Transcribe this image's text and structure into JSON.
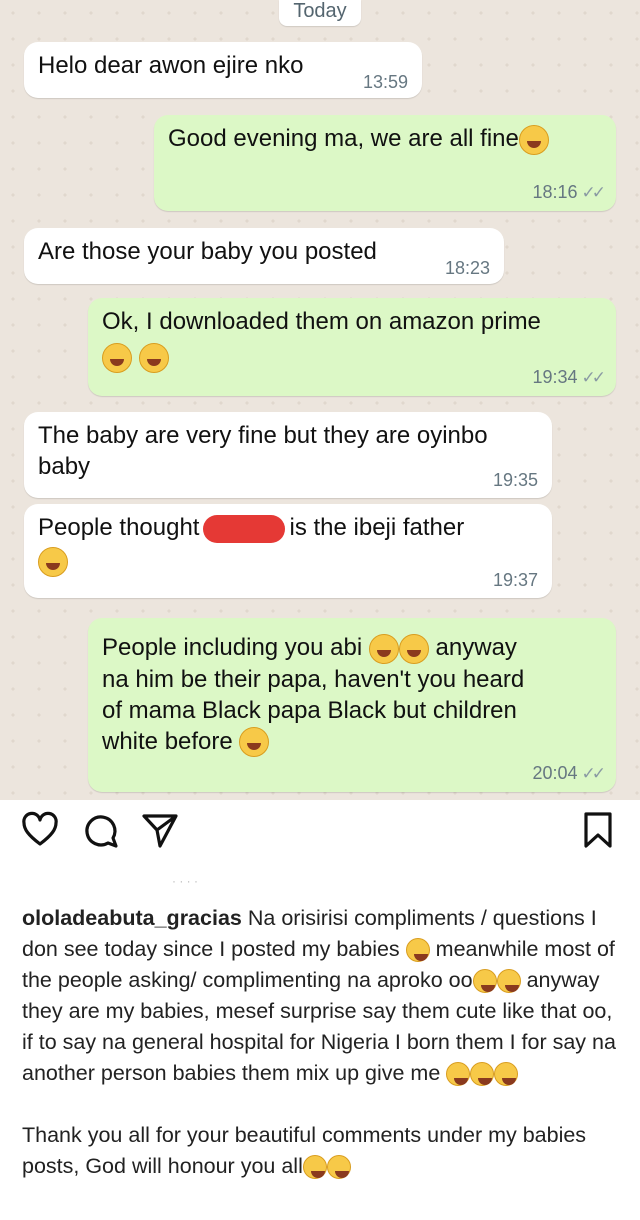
{
  "chat": {
    "date_label": "Today",
    "messages": [
      {
        "text": "Helo dear awon ejire nko",
        "time": "13:59"
      },
      {
        "text": "Good evening ma, we are all fine",
        "time": "18:16"
      },
      {
        "text": "Are those your baby you posted",
        "time": "18:23"
      },
      {
        "text": "Ok, I downloaded them on amazon prime",
        "time": "19:34"
      },
      {
        "text_line1": "The baby are very fine but they are oyinbo",
        "text_line2": "baby",
        "time": "19:35"
      },
      {
        "text_before": "People thought",
        "text_after": "is the ibeji father",
        "time": "19:37"
      },
      {
        "line1_before": "People including you abi",
        "line1_after": "anyway",
        "line2": "na him be their papa, haven't you heard",
        "line3": "of mama Black papa Black but children",
        "line4": "white before",
        "time": "20:04"
      }
    ],
    "read_ticks": "✓✓"
  },
  "post": {
    "icons": [
      "heart-icon",
      "comment-icon",
      "share-icon",
      "bookmark-icon"
    ],
    "username": "ololadeabuta_gracias",
    "caption_p1": "Na orisirisi compliments / questions I don see today since I posted my babies",
    "caption_p1b": "meanwhile most of the people asking/ complimenting na aproko oo",
    "caption_p1c": "anyway they are my babies, mesef surprise say them cute like that oo, if to say na general hospital for Nigeria I born them I for say na another person babies them mix up give me",
    "caption_p2": "Thank you all for your beautiful comments under my babies posts, God will honour you all"
  }
}
